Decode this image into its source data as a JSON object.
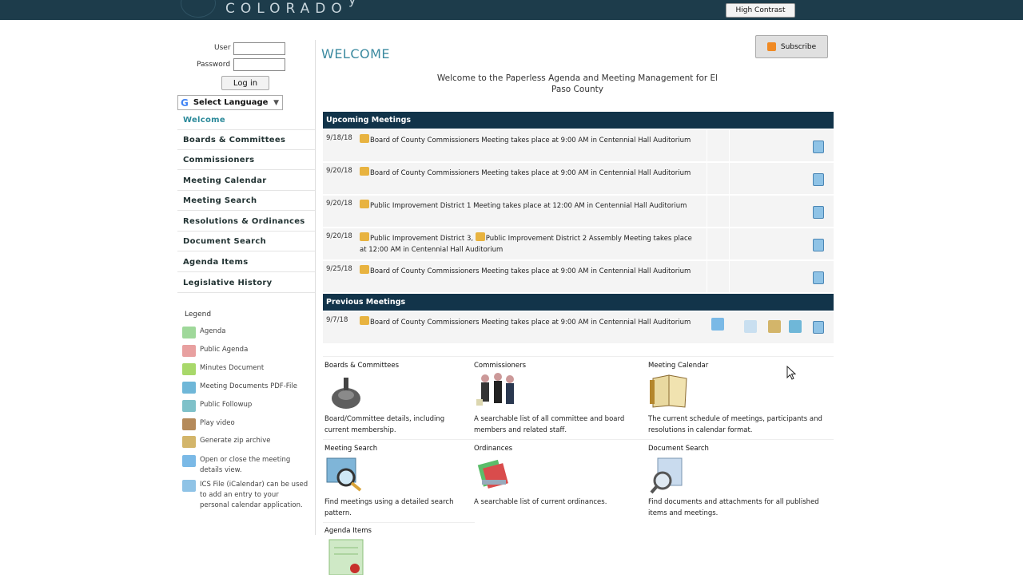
{
  "header": {
    "brand": "COLORADO",
    "brand_partial": "y",
    "high_contrast_label": "High Contrast"
  },
  "login": {
    "user_label": "User",
    "password_label": "Password",
    "button_label": "Log in"
  },
  "language": {
    "label": "Select Language",
    "g_glyph": "G",
    "arrow": "▼"
  },
  "nav": {
    "items": [
      {
        "label": "Welcome"
      },
      {
        "label": "Boards & Committees"
      },
      {
        "label": "Commissioners"
      },
      {
        "label": "Meeting Calendar"
      },
      {
        "label": "Meeting Search"
      },
      {
        "label": "Resolutions & Ordinances"
      },
      {
        "label": "Document Search"
      },
      {
        "label": "Agenda Items"
      },
      {
        "label": "Legislative History"
      }
    ]
  },
  "legend": {
    "title": "Legend",
    "items": [
      {
        "label": "Agenda",
        "icon": "agenda-icon",
        "color": "#9fd89a"
      },
      {
        "label": "Public Agenda",
        "icon": "public-agenda-icon",
        "color": "#e8a0a0"
      },
      {
        "label": "Minutes Document",
        "icon": "minutes-icon",
        "color": "#a8d86a"
      },
      {
        "label": "Meeting Documents PDF-File",
        "icon": "pdf-file-icon",
        "color": "#6fb7d8"
      },
      {
        "label": "Public Followup",
        "icon": "followup-icon",
        "color": "#7fc1c9"
      },
      {
        "label": "Play video",
        "icon": "video-icon",
        "color": "#b58a5a"
      },
      {
        "label": "Generate zip archive",
        "icon": "zip-icon",
        "color": "#d3b56a"
      },
      {
        "label": "Open or close the meeting details view.",
        "icon": "details-icon",
        "color": "#7ab9e6"
      },
      {
        "label": "ICS File (iCalendar) can be used to add an entry to your personal calendar application.",
        "icon": "ics-icon",
        "color": "#8fc3e6"
      }
    ]
  },
  "main": {
    "title": "WELCOME",
    "subscribe_label": "Subscribe",
    "intro": "Welcome to the Paperless Agenda and Meeting Management for El Paso County"
  },
  "upcoming": {
    "heading": "Upcoming Meetings",
    "rows": [
      {
        "date": "9/18/18",
        "text": "Board of County Commissioners Meeting takes place at 9:00 AM in Centennial Hall Auditorium"
      },
      {
        "date": "9/20/18",
        "text": "Board of County Commissioners Meeting takes place at 9:00 AM in Centennial Hall Auditorium"
      },
      {
        "date": "9/20/18",
        "text": "Public Improvement District 1 Meeting takes place at 12:00 AM in Centennial Hall Auditorium"
      },
      {
        "date": "9/20/18",
        "text": "Public Improvement District 3, ",
        "text2": "Public Improvement District 2 Assembly Meeting takes place at 12:00 AM in Centennial Hall Auditorium"
      },
      {
        "date": "9/25/18",
        "text": "Board of County Commissioners Meeting takes place at 9:00 AM in Centennial Hall Auditorium"
      }
    ]
  },
  "previous": {
    "heading": "Previous Meetings",
    "rows": [
      {
        "date": "9/7/18",
        "text": "Board of County Commissioners Meeting takes place at 9:00 AM in Centennial Hall Auditorium"
      }
    ]
  },
  "cards": [
    {
      "title": "Boards & Committees",
      "desc": "Board/Committee details, including current membership."
    },
    {
      "title": "Commissioners",
      "desc": "A searchable list of all committee and board members and related staff."
    },
    {
      "title": "Meeting Calendar",
      "desc": "The current schedule of meetings, participants and resolutions in calendar format."
    },
    {
      "title": "Meeting Search",
      "desc": "Find meetings using a detailed search pattern."
    },
    {
      "title": "Ordinances",
      "desc": "A searchable list of current ordinances."
    },
    {
      "title": "Document Search",
      "desc": "Find documents and attachments for all published items and meetings."
    },
    {
      "title": "Agenda Items",
      "desc": ""
    }
  ]
}
